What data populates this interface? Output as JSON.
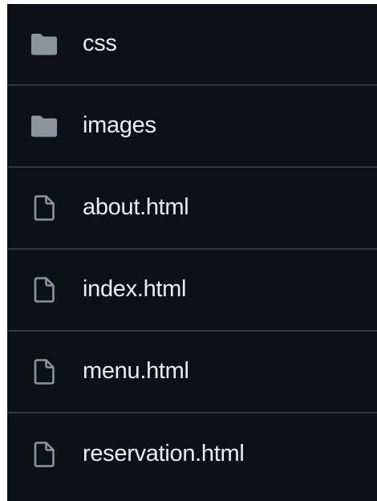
{
  "colors": {
    "background": "#0d1117",
    "divider": "#30363d",
    "text": "#e6edf3",
    "icon": "#8b949e"
  },
  "files": [
    {
      "name": "css",
      "type": "folder",
      "icon": "folder-icon"
    },
    {
      "name": "images",
      "type": "folder",
      "icon": "folder-icon"
    },
    {
      "name": "about.html",
      "type": "file",
      "icon": "file-icon"
    },
    {
      "name": "index.html",
      "type": "file",
      "icon": "file-icon"
    },
    {
      "name": "menu.html",
      "type": "file",
      "icon": "file-icon"
    },
    {
      "name": "reservation.html",
      "type": "file",
      "icon": "file-icon"
    }
  ]
}
